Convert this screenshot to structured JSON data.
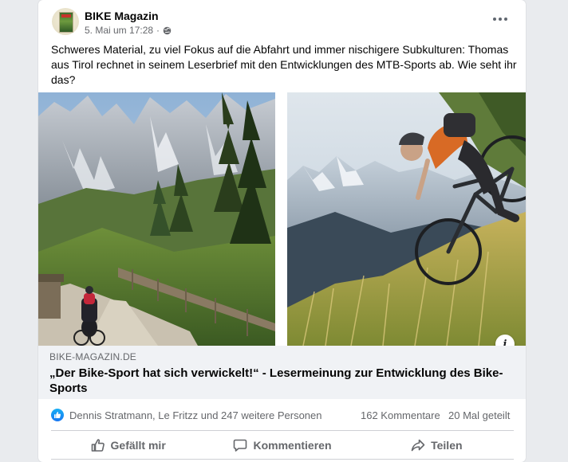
{
  "post": {
    "page_name": "BIKE Magazin",
    "timestamp": "5. Mai um 17:28",
    "audience_icon": "globe-icon",
    "more_icon": "more-options-icon",
    "text": "Schweres Material, zu viel Fokus auf die Abfahrt und immer nischigere Subkulturen: Thomas aus Tirol rechnet in seinem Leserbrief mit den Entwicklungen des MTB-Sports ab. Wie seht ihr das?"
  },
  "link_preview": {
    "domain": "BIKE-MAGAZIN.DE",
    "title": "„Der Bike-Sport hat sich verwickelt!“ - Lesermeinung zur Entwicklung des Bike-Sports",
    "info_icon": "info-icon",
    "info_label": "i"
  },
  "stats": {
    "reaction_icon": "like-reaction-icon",
    "reactions_text": "Dennis Stratmann, Le Fritzz und 247 weitere Personen",
    "comments": "162 Kommentare",
    "shares": "20 Mal geteilt"
  },
  "actions": {
    "like_label": "Gefällt mir",
    "comment_label": "Kommentieren",
    "share_label": "Teilen"
  },
  "colors": {
    "facebook_blue": "#1877f2",
    "secondary_text": "#65676b",
    "preview_background": "#f0f2f5"
  }
}
